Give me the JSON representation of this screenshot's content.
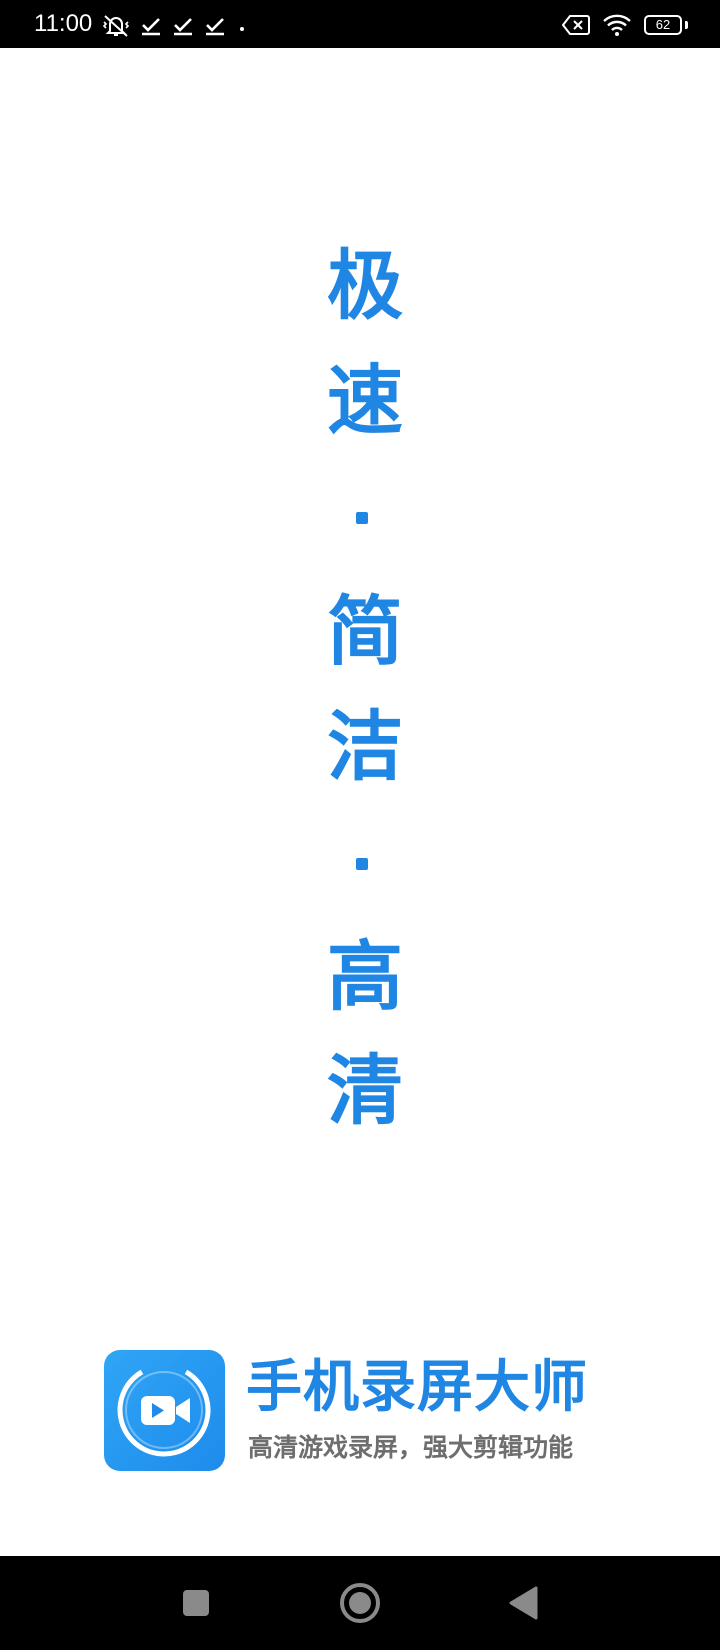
{
  "status_bar": {
    "time": "11:00",
    "battery_level": "62",
    "icons_left": [
      "mute-vibrate-icon",
      "check-notification-icon",
      "check-notification-icon",
      "check-notification-icon",
      "dot-icon"
    ],
    "icons_right": [
      "no-sim-icon",
      "wifi-icon",
      "battery-icon"
    ]
  },
  "slogan": {
    "chars": [
      "极",
      "速",
      "简",
      "洁",
      "高",
      "清"
    ]
  },
  "brand": {
    "app_name": "手机录屏大师",
    "tagline": "高清游戏录屏，强大剪辑功能",
    "icon": "video-camera-icon"
  },
  "nav_bar": {
    "buttons": [
      "recents-button",
      "home-button",
      "back-button"
    ]
  },
  "colors": {
    "accent": "#1f86e3",
    "tagline": "#6e6e6e",
    "bars": "#000000",
    "background": "#ffffff"
  }
}
